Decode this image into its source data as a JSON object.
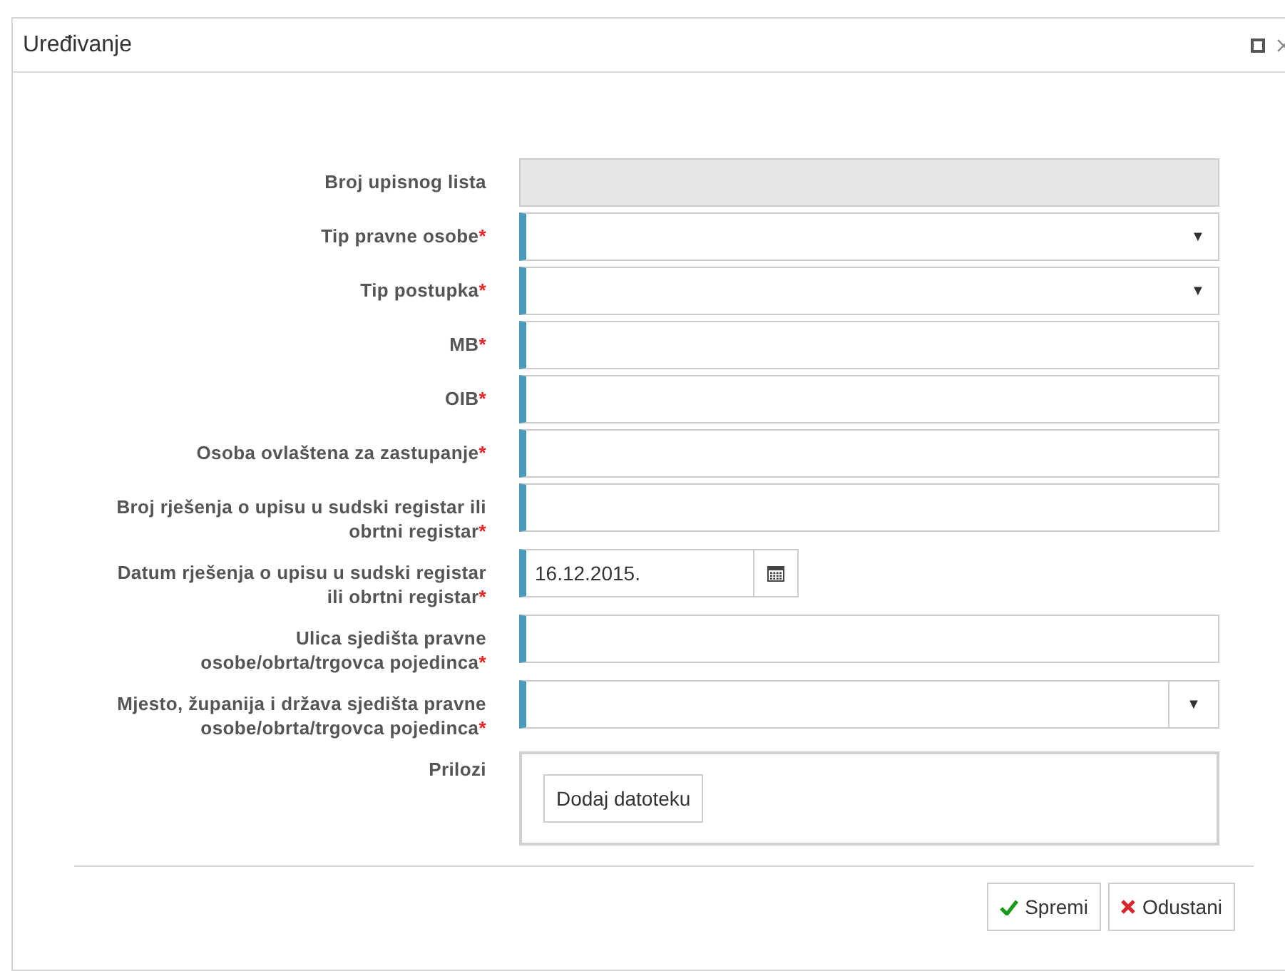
{
  "window": {
    "title": "Uređivanje"
  },
  "fields": [
    {
      "label": "Broj upisnog lista",
      "required": false,
      "kind": "readonly"
    },
    {
      "label": "Tip pravne osobe",
      "required": true,
      "kind": "select",
      "arrow": "▼"
    },
    {
      "label": "Tip postupka",
      "required": true,
      "kind": "select",
      "arrow": "▼"
    },
    {
      "label": "MB",
      "required": true,
      "kind": "text"
    },
    {
      "label": "OIB",
      "required": true,
      "kind": "text"
    },
    {
      "label": "Osoba ovlaštena za zastupanje",
      "required": true,
      "kind": "text"
    },
    {
      "label": "Broj rješenja o upisu u sudski registar ili obrtni registar",
      "required": true,
      "kind": "text"
    },
    {
      "label": "Datum rješenja o upisu u sudski registar ili obrtni registar",
      "required": true,
      "kind": "date",
      "value": "16.12.2015."
    },
    {
      "label": "Ulica sjedišta pravne osobe/obrta/trgovca pojedinca",
      "required": true,
      "kind": "text"
    },
    {
      "label": "Mjesto, županija i država sjedišta pravne osobe/obrta/trgovca pojedinca",
      "required": true,
      "kind": "combobox",
      "arrow": "▼"
    },
    {
      "label": "Prilozi",
      "required": false,
      "kind": "attachments",
      "button": "Dodaj datoteku"
    }
  ],
  "required_mark": "*",
  "buttons": [
    {
      "label": "Spremi",
      "kind": "save"
    },
    {
      "label": "Odustani",
      "kind": "cancel"
    }
  ]
}
